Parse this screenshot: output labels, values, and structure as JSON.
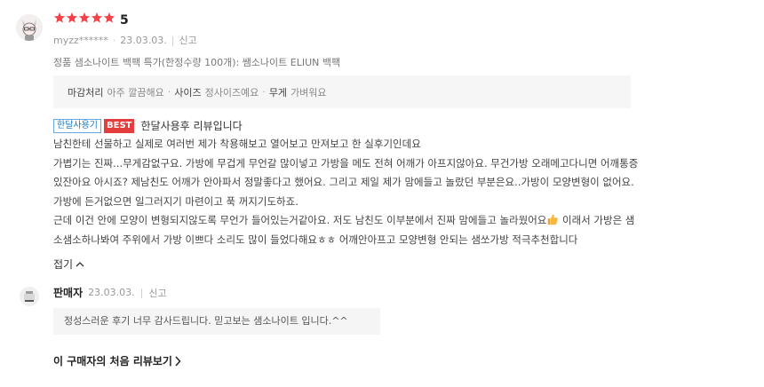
{
  "review": {
    "rating_value": "5",
    "rating_stars": 5,
    "user": "myzz******",
    "date": "23.03.03.",
    "report_label": "신고",
    "product": "정품 샘소나이트 백팩 특가(한정수량 100개): 쌤소나이트 ELIUN 백팩",
    "attributes": [
      {
        "name": "마감처리",
        "value": "아주 깔끔해요"
      },
      {
        "name": "사이즈",
        "value": "정사이즈예요"
      },
      {
        "name": "무게",
        "value": "가벼워요"
      }
    ],
    "tag_period": "한달사용기",
    "tag_best": "BEST",
    "title": "한달사용후 리뷰입니다",
    "body_lines": [
      "남친한테 선물하고 실제로 여러번 제가 착용해보고 열어보고 만져보고 한 실후기인데요",
      "가볍기는 진짜...무게감없구요. 가방에 무겁게 무언갈 많이넣고 가방을 메도 전혀 어깨가 아프지않아요. 무건가방 오래메고다니면 어깨통증",
      "있잔아요 아시죠? 제남친도 어깨가 안아파서 정말좋다고 했어요. 그리고 제일 제가 맘에들고 놀랐던 부분은요..가방이 모양변형이 없어요.",
      "가방에 든거없으면 일그러지기 마련이고 푹 꺼지기도하죠.",
      "근데 이건 안에 모양이 변형되지않도록 무언가 들어있는거같아요. 저도 남친도 이부분에서 진짜 맘에들고 놀라웠어요",
      "소샘소하나봐여 주위에서 가방 이쁘다 소리도 많이 들었다해요ㅎㅎ 어깨안아프고 모양변형 안되는 샘쏘가방 적극추천합니다"
    ],
    "body_line5_tail": " 이래서 가방은 샘",
    "collapse_label": "접기"
  },
  "seller": {
    "name": "판매자",
    "date": "23.03.03.",
    "report_label": "신고",
    "reply": "정성스러운 후기 너무 감사드립니다. 믿고보는 샘소나이트 입니다.^^"
  },
  "first_reviews_label": "이 구매자의 처음 리뷰보기",
  "colors": {
    "star": "#f4424b",
    "best": "#e33e3e",
    "period_tag": "#1e79c8"
  },
  "icons": {
    "avatar": "avatar-icon",
    "seller": "seller-logo-icon",
    "thumb": "thumbs-up-icon",
    "chevron_up": "chevron-up-icon",
    "chevron_right": "chevron-right-icon"
  }
}
